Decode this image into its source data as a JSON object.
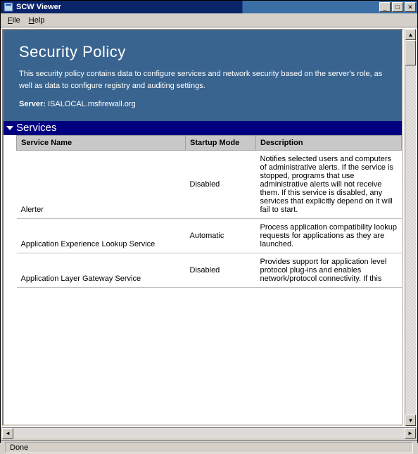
{
  "window": {
    "title": "SCW Viewer",
    "minimize_tip": "Minimize",
    "maximize_tip": "Maximize",
    "close_tip": "Close"
  },
  "menu": {
    "file": "File",
    "help": "Help"
  },
  "header": {
    "title": "Security Policy",
    "description": "This security policy contains data to configure services and network security based on the server's role, as well as data to configure registry and auditing settings.",
    "server_label": "Server:",
    "server_value": "ISALOCAL.msfirewall.org"
  },
  "section": {
    "services_label": "Services"
  },
  "table": {
    "columns": {
      "name": "Service Name",
      "mode": "Startup Mode",
      "desc": "Description"
    },
    "rows": [
      {
        "name": "Alerter",
        "mode": "Disabled",
        "desc": "Notifies selected users and computers of administrative alerts. If the service is stopped, programs that use administrative alerts will not receive them. If this service is disabled, any services that explicitly depend on it will fail to start."
      },
      {
        "name": "Application Experience Lookup Service",
        "mode": "Automatic",
        "desc": "Process application compatibility lookup requests for applications as they are launched."
      },
      {
        "name": "Application Layer Gateway Service",
        "mode": "Disabled",
        "desc": "Provides support for application level protocol plug-ins and enables network/protocol connectivity. If this"
      }
    ]
  },
  "status": {
    "text": "Done"
  }
}
